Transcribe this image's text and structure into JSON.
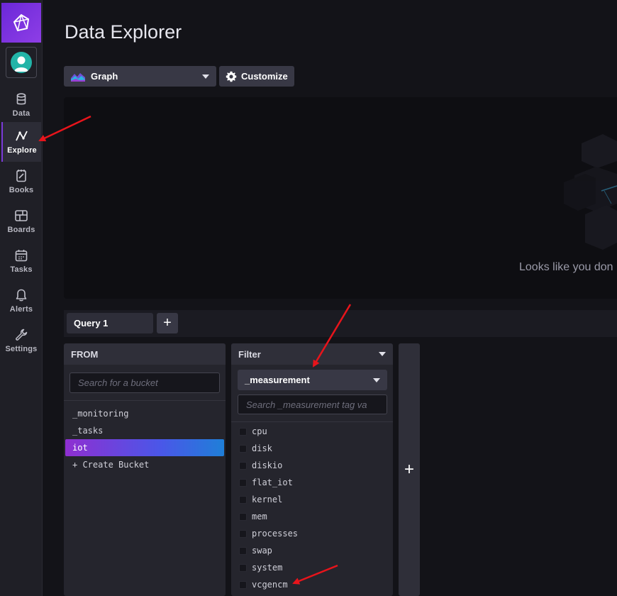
{
  "page": {
    "title": "Data Explorer"
  },
  "sidebar": {
    "items": [
      {
        "label": "Data",
        "icon": "database-icon"
      },
      {
        "label": "Explore",
        "icon": "explore-graph-icon",
        "active": true
      },
      {
        "label": "Books",
        "icon": "notebook-icon"
      },
      {
        "label": "Boards",
        "icon": "dashboard-icon"
      },
      {
        "label": "Tasks",
        "icon": "calendar-icon"
      },
      {
        "label": "Alerts",
        "icon": "bell-icon"
      },
      {
        "label": "Settings",
        "icon": "wrench-icon"
      }
    ]
  },
  "toolbar": {
    "graph_type": "Graph",
    "customize_label": "Customize"
  },
  "graph_panel": {
    "empty_message": "Looks like you don"
  },
  "query_tabs": {
    "tabs": [
      {
        "label": "Query 1"
      }
    ],
    "add_label": "+"
  },
  "from": {
    "header": "FROM",
    "search_placeholder": "Search for a bucket",
    "buckets": [
      "_monitoring",
      "_tasks",
      "iot",
      "+ Create Bucket"
    ],
    "selected": "iot"
  },
  "filter": {
    "header": "Filter",
    "key": "_measurement",
    "search_placeholder": "Search _measurement tag va",
    "values": [
      "cpu",
      "disk",
      "diskio",
      "flat_iot",
      "kernel",
      "mem",
      "processes",
      "swap",
      "system",
      "vcgencm"
    ]
  },
  "add_column_label": "+",
  "colors": {
    "brand_purple": "#7a3ad9",
    "selected_gradient_start": "#8f2fd1",
    "selected_gradient_end": "#1f7fd8",
    "annotation_arrow": "#e8141b"
  }
}
